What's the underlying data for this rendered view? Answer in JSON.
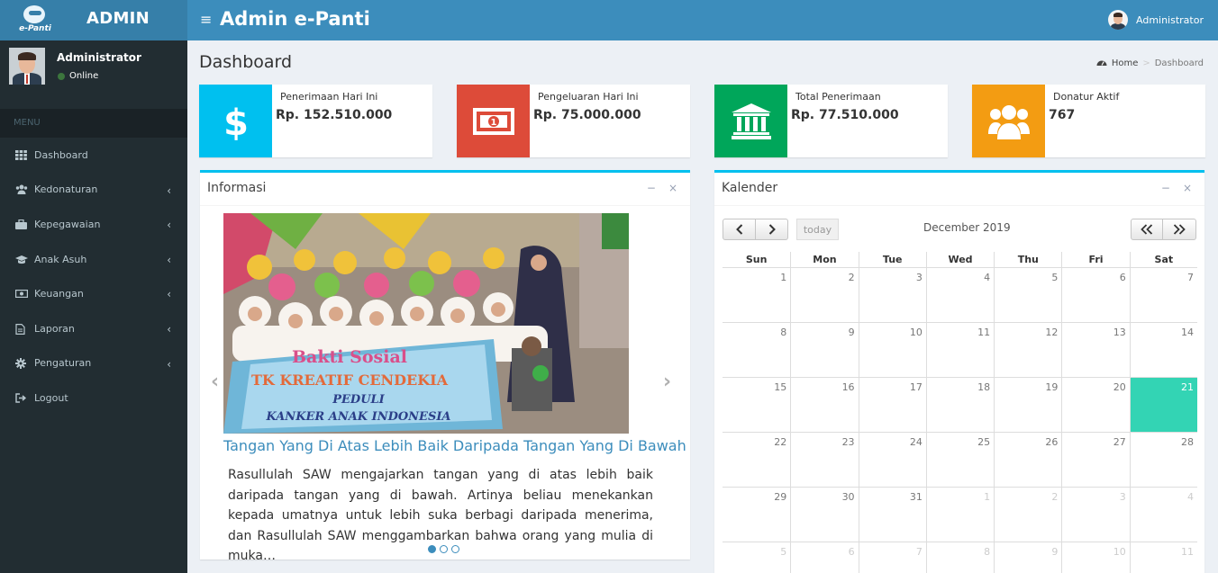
{
  "brand": {
    "logo_caption": "e-Panti",
    "name": "ADMIN"
  },
  "header": {
    "app_title": "Admin e-Panti",
    "user_name": "Administrator"
  },
  "sidebar": {
    "user": {
      "name": "Administrator",
      "status": "Online"
    },
    "menu_header": "MENU",
    "items": [
      {
        "label": "Dashboard",
        "icon": "th-icon",
        "has_submenu": false
      },
      {
        "label": "Kedonaturan",
        "icon": "users-icon",
        "has_submenu": true
      },
      {
        "label": "Kepegawaian",
        "icon": "briefcase-icon",
        "has_submenu": true
      },
      {
        "label": "Anak Asuh",
        "icon": "graduation-cap-icon",
        "has_submenu": true
      },
      {
        "label": "Keuangan",
        "icon": "money-icon",
        "has_submenu": true
      },
      {
        "label": "Laporan",
        "icon": "file-icon",
        "has_submenu": true
      },
      {
        "label": "Pengaturan",
        "icon": "gear-icon",
        "has_submenu": true
      },
      {
        "label": "Logout",
        "icon": "sign-out-icon",
        "has_submenu": false
      }
    ]
  },
  "page": {
    "title": "Dashboard",
    "breadcrumb": {
      "home": "Home",
      "current": "Dashboard"
    }
  },
  "info_boxes": [
    {
      "label": "Penerimaan Hari Ini",
      "value": "Rp. 152.510.000",
      "icon": "dollar-icon",
      "color": "#00c0ef"
    },
    {
      "label": "Pengeluaran Hari Ini",
      "value": "Rp. 75.000.000",
      "icon": "money-icon",
      "color": "#dd4b39"
    },
    {
      "label": "Total Penerimaan",
      "value": "Rp. 77.510.000",
      "icon": "bank-icon",
      "color": "#00a65a"
    },
    {
      "label": "Donatur Aktif",
      "value": "767",
      "icon": "users-icon",
      "color": "#f39c12"
    }
  ],
  "informasi": {
    "title": "Informasi",
    "banner_lines": [
      "Bakti Sosial",
      "TK KREATIF CENDEKIA",
      "PEDULI",
      "KANKER ANAK INDONESIA"
    ],
    "slide_title": "Tangan Yang Di Atas Lebih Baik Daripada Tangan Yang Di Bawah",
    "slide_text": "Rasullulah SAW mengajarkan tangan yang di atas lebih baik daripada tangan yang di bawah. Artinya beliau menekankan kepada umatnya untuk lebih suka berbagi daripada menerima, dan Rasullulah SAW menggambarkan bahwa orang yang mulia di muka…",
    "slide_count": 3,
    "active_slide": 1
  },
  "kalender": {
    "title": "Kalender",
    "today_label": "today",
    "month_title": "December 2019",
    "weekdays": [
      "Sun",
      "Mon",
      "Tue",
      "Wed",
      "Thu",
      "Fri",
      "Sat"
    ],
    "weeks": [
      [
        {
          "d": "1"
        },
        {
          "d": "2"
        },
        {
          "d": "3"
        },
        {
          "d": "4"
        },
        {
          "d": "5"
        },
        {
          "d": "6"
        },
        {
          "d": "7"
        }
      ],
      [
        {
          "d": "8"
        },
        {
          "d": "9"
        },
        {
          "d": "10"
        },
        {
          "d": "11"
        },
        {
          "d": "12"
        },
        {
          "d": "13"
        },
        {
          "d": "14"
        }
      ],
      [
        {
          "d": "15"
        },
        {
          "d": "16"
        },
        {
          "d": "17"
        },
        {
          "d": "18"
        },
        {
          "d": "19"
        },
        {
          "d": "20"
        },
        {
          "d": "21",
          "today": true
        }
      ],
      [
        {
          "d": "22"
        },
        {
          "d": "23"
        },
        {
          "d": "24"
        },
        {
          "d": "25"
        },
        {
          "d": "26"
        },
        {
          "d": "27"
        },
        {
          "d": "28"
        }
      ],
      [
        {
          "d": "29"
        },
        {
          "d": "30"
        },
        {
          "d": "31"
        },
        {
          "d": "1",
          "other": true
        },
        {
          "d": "2",
          "other": true
        },
        {
          "d": "3",
          "other": true
        },
        {
          "d": "4",
          "other": true
        }
      ],
      [
        {
          "d": "5",
          "other": true
        },
        {
          "d": "6",
          "other": true
        },
        {
          "d": "7",
          "other": true
        },
        {
          "d": "8",
          "other": true
        },
        {
          "d": "9",
          "other": true
        },
        {
          "d": "10",
          "other": true
        },
        {
          "d": "11",
          "other": true
        }
      ]
    ],
    "today_color": "#33d4b4"
  }
}
